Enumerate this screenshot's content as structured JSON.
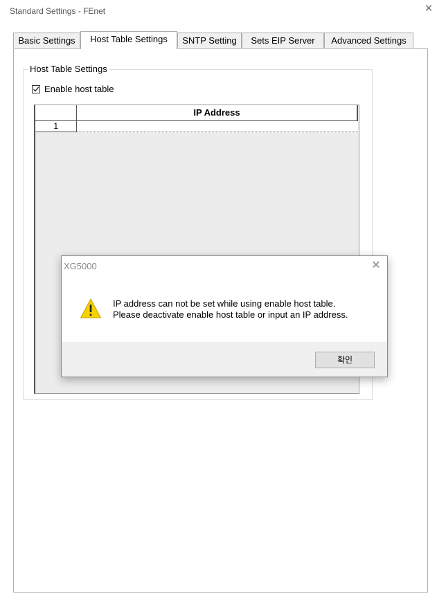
{
  "window": {
    "title": "Standard Settings - FEnet",
    "close_icon": "close-icon"
  },
  "tabs": [
    {
      "label": "Basic Settings",
      "active": false
    },
    {
      "label": "Host Table Settings",
      "active": true
    },
    {
      "label": "SNTP Setting",
      "active": false
    },
    {
      "label": "Sets EIP Server",
      "active": false
    },
    {
      "label": "Advanced Settings",
      "active": false
    }
  ],
  "host_table": {
    "group_label": "Host Table Settings",
    "enable_checkbox": {
      "label": "Enable host table",
      "checked": true
    },
    "grid": {
      "columns": [
        "",
        "IP Address"
      ],
      "rows": [
        {
          "index": "1",
          "ip": ""
        }
      ]
    }
  },
  "message_box": {
    "title": "XG5000",
    "icon": "warning-icon",
    "lines": [
      "IP address can not be set while using enable host table.",
      "Please deactivate enable host table or input an IP address."
    ],
    "ok_label": "확인"
  },
  "colors": {
    "warning": "#f5d100",
    "panel_bg": "#f0f0f0",
    "grid_bg": "#ececec"
  }
}
